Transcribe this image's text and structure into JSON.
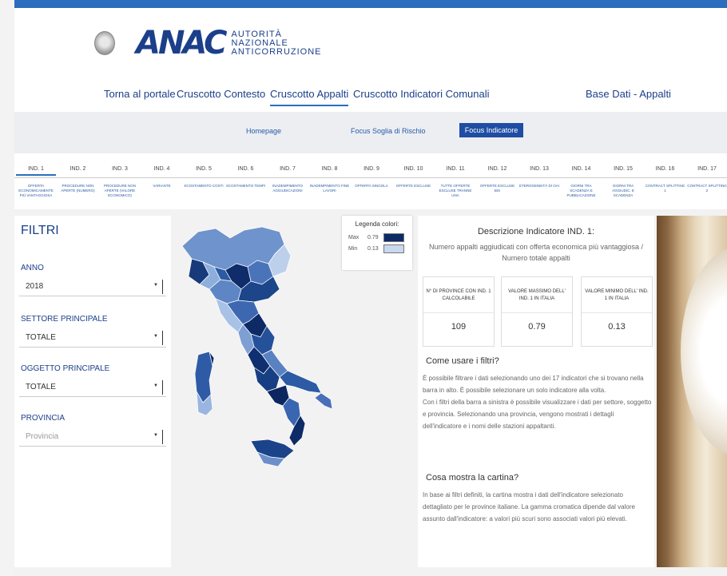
{
  "header": {
    "brand": "ANAC",
    "brand_sub_1": "AUTORITÀ",
    "brand_sub_2": "NAZIONALE",
    "brand_sub_3": "ANTICORRUZIONE"
  },
  "nav": {
    "items": [
      "Torna al portale",
      "Cruscotto Contesto",
      "Cruscotto Appalti",
      "Cruscotto Indicatori Comunali"
    ],
    "active": "Cruscotto Appalti",
    "right_label": "Base Dati - Appalti"
  },
  "subnav": {
    "homepage": "Homepage",
    "focus_soglia": "Focus Soglia di Rischio",
    "focus_indicatore": "Focus Indicatore"
  },
  "tabs": [
    "IND. 1",
    "IND. 2",
    "IND. 3",
    "IND. 4",
    "IND. 5",
    "IND. 6",
    "IND. 7",
    "IND. 8",
    "IND. 9",
    "IND. 10",
    "IND. 11",
    "IND. 12",
    "IND. 13",
    "IND. 14",
    "IND. 15",
    "IND. 16",
    "IND. 17"
  ],
  "tab_descriptions": [
    "OFFERTA ECONOMICAMENTE PIÙ VANTAGGIOSA",
    "PROCEDURE NON APERTE (NUMERO)",
    "PROCEDURE NON APERTE (VALORE ECONOMICO)",
    "VARIANTE",
    "SCOSTAMENTO COSTI",
    "SCOSTAMENTO TEMPI",
    "INADEMPIMENTO AGGIUDICAZIONI",
    "INADEMPIMENTO FINE LAVORI",
    "OFFERTA SINGOLA",
    "OFFERTE ESCLUSE",
    "TUTTE OFFERTE ESCLUSE TRANNE UNA",
    "OFFERTE ESCLUSE BIS",
    "ETEROGENEITÀ DI OAI",
    "GIORNI TRA SCADENZA E PUBBLICAZIONE",
    "GIORNI TRA AGGIUDIC. E SCADENZA",
    "CONTRACT SPLITTING 1",
    "CONTRACT SPLITTING 2"
  ],
  "filters": {
    "title": "FILTRI",
    "anno_label": "ANNO",
    "anno_value": "2018",
    "settore_label": "SETTORE PRINCIPALE",
    "settore_value": "TOTALE",
    "oggetto_label": "OGGETTO PRINCIPALE",
    "oggetto_value": "TOTALE",
    "provincia_label": "PROVINCIA",
    "provincia_placeholder": "Provincia"
  },
  "legend": {
    "title": "Legenda colori:",
    "max_label": "Max",
    "max_value": "0.79",
    "min_label": "Min",
    "min_value": "0.13"
  },
  "info": {
    "title": "Descrizione Indicatore IND. 1:",
    "formula": "Numero appalti aggiudicati con offerta economica più vantaggiosa / Numero totale appalti",
    "cards": [
      {
        "title": "N° DI PROVINCE CON IND. 1 CALCOLABILE",
        "value": "109"
      },
      {
        "title": "VALORE MASSIMO DELL' IND. 1 IN ITALIA",
        "value": "0.79"
      },
      {
        "title": "VALORE MINIMO DELL' IND. 1 IN ITALIA",
        "value": "0.13"
      }
    ],
    "how_title": "Come usare i filtri?",
    "how_text_1": "È possibile filtrare i dati selezionando uno dei 17 indicatori che si trovano nella barra in alto. È possibile selezionare un solo indicatore alla volta.",
    "how_text_2": "Con i filtri della barra a sinistra è possibile visualizzare i dati per settore, soggetto e provincia. Selezionando una provincia, vengono mostrati i dettagli dell'indicatore e i nomi delle stazioni appaltanti.",
    "map_title": "Cosa mostra la cartina?",
    "map_text": "In base ai filtri definiti, la cartina mostra i dati dell'indicatore selezionato dettagliato per le province italiane. La gamma cromatica dipende dal valore assunto dall'indicatore: a valori più scuri sono associati valori più elevati."
  },
  "colors": {
    "accent": "#2a6ebd",
    "brand": "#1b3f8a",
    "map_dark": "#0d2a66",
    "map_light": "#c9d8ee"
  }
}
